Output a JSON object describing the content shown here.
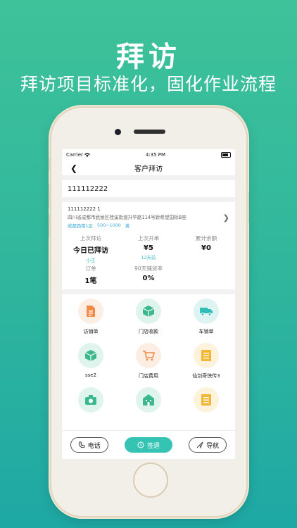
{
  "hero": {
    "title": "拜访",
    "subtitle": "拜访项目标准化，固化作业流程"
  },
  "status_bar": {
    "carrier": "Carrier",
    "time": "4:35 PM"
  },
  "nav": {
    "title": "客户拜访"
  },
  "search": {
    "value": "111112222"
  },
  "customer": {
    "id_line": "111112222  1",
    "address": "四川省成都市武侯区桂溪街道升华路114号新希望国际B座",
    "tags": [
      "成都西南1区",
      "500~1000",
      "黄"
    ]
  },
  "stats": [
    {
      "label": "上次拜访",
      "value": "今日已拜访",
      "sub": "小王"
    },
    {
      "label": "上次开单",
      "value": "¥5",
      "sub": "12天前"
    },
    {
      "label": "累计余额",
      "value": "¥0",
      "sub": ""
    },
    {
      "label": "订单",
      "value": "1笔",
      "sub": ""
    },
    {
      "label": "90天铺货率",
      "value": "0%",
      "sub": ""
    }
  ],
  "actions": [
    {
      "label": "访销单",
      "icon": "document-icon",
      "bg": "#fdeee4",
      "color": "#f08a48"
    },
    {
      "label": "门店收款",
      "icon": "box-icon",
      "bg": "#dff4ec",
      "color": "#3cb98c"
    },
    {
      "label": "车销单",
      "icon": "truck-icon",
      "bg": "#def4f3",
      "color": "#32bdb6"
    },
    {
      "label": "sse2",
      "icon": "box-icon",
      "bg": "#dff4ec",
      "color": "#3cb98c"
    },
    {
      "label": "门店费用",
      "icon": "cart-icon",
      "bg": "#fdeee4",
      "color": "#f08a48"
    },
    {
      "label": "仙剑奇侠传3",
      "icon": "list-icon",
      "bg": "#fdf3dc",
      "color": "#f2b632"
    },
    {
      "label": "",
      "icon": "camera-icon",
      "bg": "#dff4ec",
      "color": "#3cb98c"
    },
    {
      "label": "",
      "icon": "store-icon",
      "bg": "#dff4ec",
      "color": "#3cb98c"
    },
    {
      "label": "",
      "icon": "list-icon",
      "bg": "#fdf3dc",
      "color": "#f2b632"
    }
  ],
  "bottom": {
    "phone": "电话",
    "checkout": "签退",
    "navigate": "导航"
  }
}
